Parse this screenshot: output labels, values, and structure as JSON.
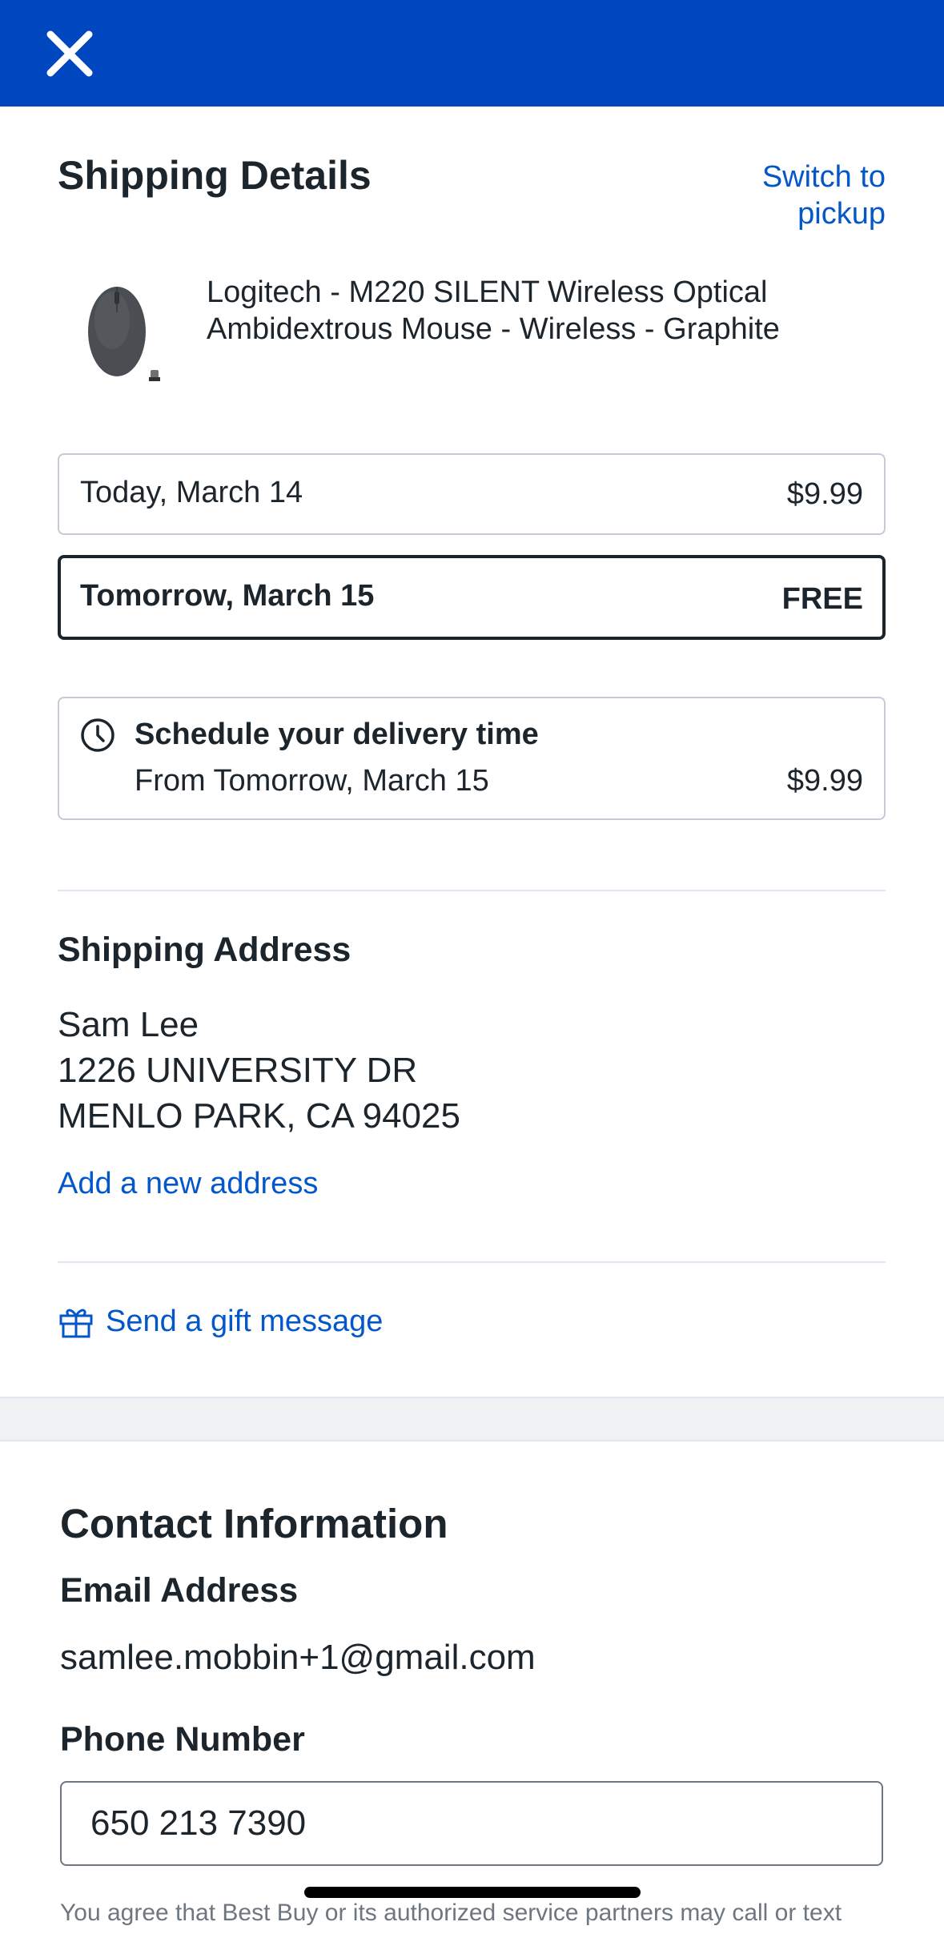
{
  "header": {
    "close_icon": "close-icon",
    "bar_color": "#0046be"
  },
  "shipping": {
    "title": "Shipping Details",
    "switch_link": "Switch to pickup",
    "product": {
      "image_icon": "mouse-product-image",
      "name": "Logitech - M220 SILENT Wireless Optical Ambidextrous Mouse - Wireless - Graphite"
    },
    "options": [
      {
        "date": "Today, March 14",
        "price": "$9.99",
        "selected": false
      },
      {
        "date": "Tomorrow, March 15",
        "price": "FREE",
        "selected": true
      }
    ],
    "schedule": {
      "icon": "clock-icon",
      "title": "Schedule your delivery time",
      "subtitle": "From Tomorrow, March 15",
      "price": "$9.99"
    }
  },
  "address": {
    "title": "Shipping Address",
    "name": "Sam Lee",
    "street": "1226 UNIVERSITY DR",
    "city": "MENLO PARK, CA 94025",
    "add_link": "Add a new address"
  },
  "gift": {
    "icon": "gift-icon",
    "label": "Send a gift message"
  },
  "contact": {
    "title": "Contact Information",
    "email_label": "Email Address",
    "email": "samlee.mobbin+1@gmail.com",
    "phone_label": "Phone Number",
    "phone": "650 213 7390",
    "disclaimer": "You agree that Best Buy or its authorized service partners may call or text"
  },
  "colors": {
    "brand_blue": "#0046be",
    "link_blue": "#0457c8",
    "text": "#1d252c",
    "border": "#c5cbd5"
  }
}
